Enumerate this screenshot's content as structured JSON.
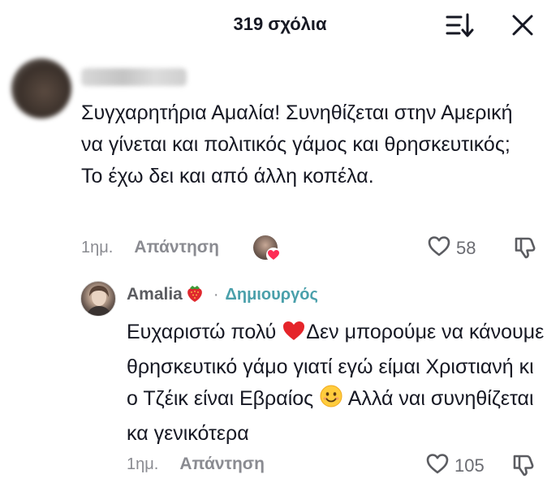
{
  "header": {
    "title": "319 σχόλια",
    "sort_icon": "sort-descending-icon",
    "close_icon": "close-icon"
  },
  "comment": {
    "text": "Συγχαρητήρια Αμαλία! Συνηθίζεται στην Αμερική να γίνεται και πολιτικός γάμος και θρησκευτικός; Το έχω δει και από άλλη κοπέλα.",
    "time": "1ημ.",
    "reply_label": "Απάντηση",
    "likes": "58",
    "creator_liked": true
  },
  "reply": {
    "author": "Amalia",
    "author_emoji": "strawberry",
    "separator": "·",
    "badge": "Δημιουργός",
    "text_part1": "Ευχαριστώ πολύ ",
    "emoji1": "red-heart",
    "text_part2": "Δεν μπορούμε να κάνουμε θρησκευτικό γάμο γιατί εγώ είμαι Χριστιανή κι ο Τζέικ είναι Εβραίος ",
    "emoji2": "smiling-face",
    "text_part3": " Αλλά ναι συνηθίζεται κα γενικότερα",
    "time": "1ημ.",
    "reply_label": "Απάντηση",
    "likes": "105"
  },
  "colors": {
    "text": "#161823",
    "muted": "#8a8b91",
    "creator": "#4aa0ab",
    "heart": "#e5242a"
  }
}
